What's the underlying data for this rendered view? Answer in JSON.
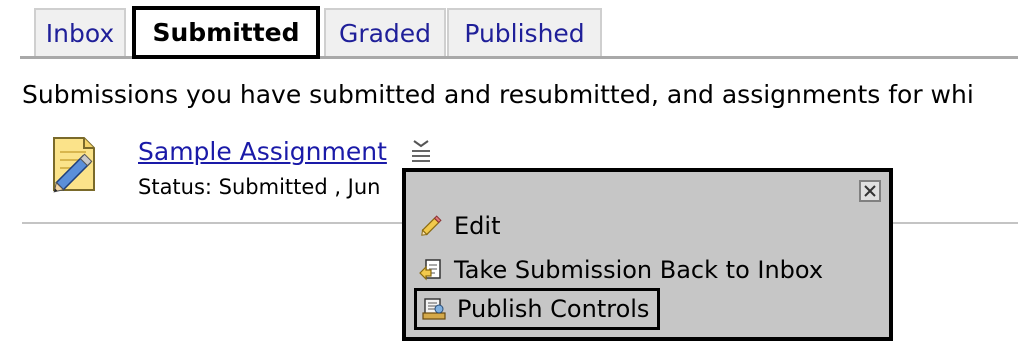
{
  "tabs": [
    {
      "label": "Inbox",
      "active": false
    },
    {
      "label": "Submitted",
      "active": true
    },
    {
      "label": "Graded",
      "active": false
    },
    {
      "label": "Published",
      "active": false
    }
  ],
  "description": "Submissions you have submitted and resubmitted, and assignments for whi",
  "assignment": {
    "title": "Sample Assignment",
    "status": "Status: Submitted , Jun",
    "icon": "assignment-pencil-icon",
    "menu_icon": "action-menu-icon"
  },
  "context_menu": {
    "close_icon": "close-icon",
    "items": [
      {
        "label": "Edit",
        "icon": "pencil-icon"
      },
      {
        "label": "Take Submission Back to Inbox",
        "icon": "take-back-icon"
      },
      {
        "label": "Publish Controls",
        "icon": "publish-controls-icon"
      }
    ]
  },
  "colors": {
    "link": "#1a1aa8",
    "tab_text": "#1f1f99",
    "menu_bg": "#c6c6c6",
    "highlight_border": "#000000"
  }
}
